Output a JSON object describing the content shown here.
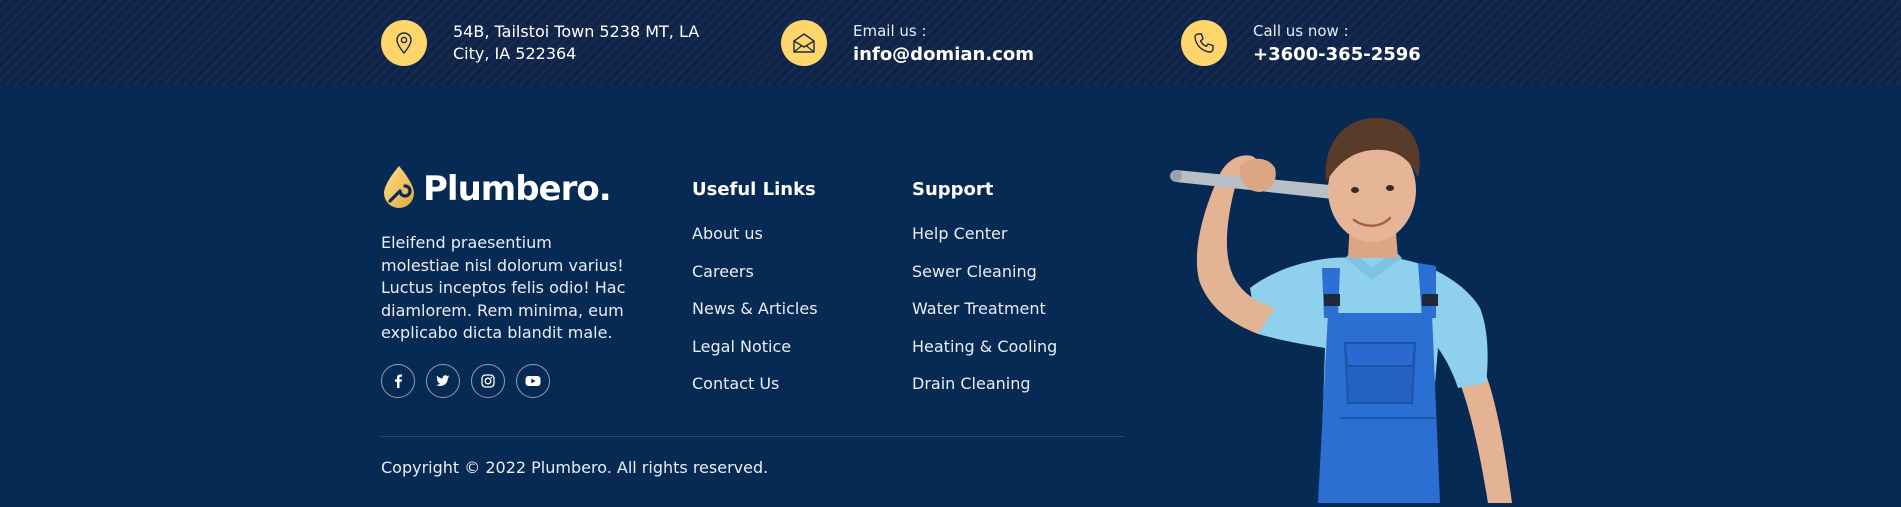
{
  "topbar": {
    "address": {
      "icon": "location-pin-icon",
      "line1": "54B, Tailstoi Town 5238 MT, LA",
      "line2": "City, IA 522364"
    },
    "email": {
      "icon": "envelope-icon",
      "label": "Email us :",
      "value": "info@domian.com"
    },
    "phone": {
      "icon": "phone-icon",
      "label": "Call us now :",
      "value": "+3600-365-2596"
    }
  },
  "brand": {
    "name": "Plumbero.",
    "logo_icon": "water-drop-wrench-icon",
    "description": "Eleifend praesentium molestiae nisl dolorum varius! Luctus inceptos felis odio! Hac diamlorem. Rem minima, eum explicabo dicta blandit male."
  },
  "socials": [
    {
      "icon": "facebook-icon"
    },
    {
      "icon": "twitter-icon"
    },
    {
      "icon": "instagram-icon"
    },
    {
      "icon": "youtube-icon"
    }
  ],
  "useful_links": {
    "title": "Useful Links",
    "items": [
      "About us",
      "Careers",
      "News & Articles",
      "Legal Notice",
      "Contact Us"
    ]
  },
  "support": {
    "title": "Support",
    "items": [
      "Help Center",
      "Sewer Cleaning",
      "Water Treatment",
      "Heating & Cooling",
      "Drain Cleaning"
    ]
  },
  "copyright": "Copyright © 2022 Plumbero. All rights reserved.",
  "colors": {
    "background": "#062a53",
    "topbar": "#0f2448",
    "accent": "#ffd66b",
    "overalls": "#2c6fd2",
    "shirt": "#8fd0ee"
  }
}
